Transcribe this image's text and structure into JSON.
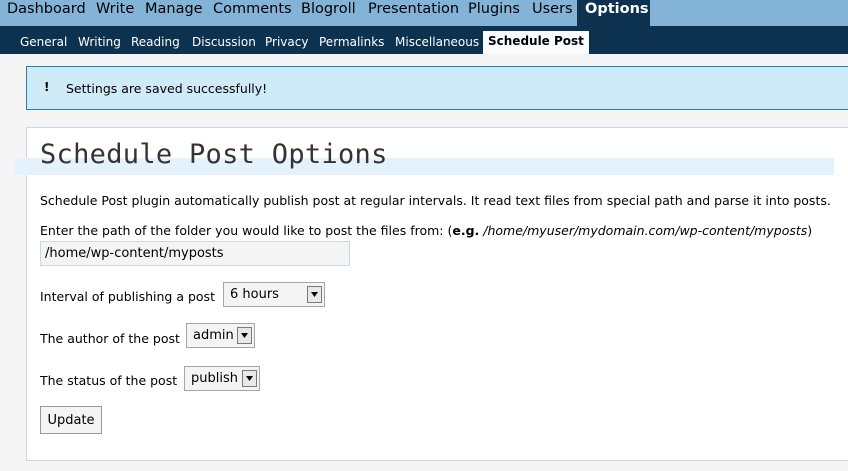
{
  "admin_menu": {
    "items": [
      {
        "label": "Dashboard"
      },
      {
        "label": "Write"
      },
      {
        "label": "Manage"
      },
      {
        "label": "Comments"
      },
      {
        "label": "Blogroll"
      },
      {
        "label": "Presentation"
      },
      {
        "label": "Plugins"
      },
      {
        "label": "Users"
      },
      {
        "label": "Options"
      }
    ],
    "active": "Options"
  },
  "sub_menu": {
    "items": [
      {
        "label": "General"
      },
      {
        "label": "Writing"
      },
      {
        "label": "Reading"
      },
      {
        "label": "Discussion"
      },
      {
        "label": "Privacy"
      },
      {
        "label": "Permalinks"
      },
      {
        "label": "Miscellaneous"
      },
      {
        "label": "Schedule Post"
      }
    ],
    "active": "Schedule Post"
  },
  "message": {
    "icon": "!",
    "text": "Settings are saved successfully!"
  },
  "page": {
    "title": "Schedule Post Options",
    "description": "Schedule Post plugin automatically publish post at regular intervals. It read text files from special path and parse it into posts.",
    "path_label_prefix": "Enter the path of the folder you would like to post the files from: (",
    "path_label_eg": "e.g.",
    "path_label_example": "/home/myuser/mydomain.com/wp-content/myposts",
    "path_label_suffix": ")",
    "path_value": "/home/wp-content/myposts",
    "interval_label": "Interval of publishing a post",
    "interval_value": "6 hours",
    "author_label": "The author of the post",
    "author_value": "admin",
    "status_label": "The status of the post",
    "status_value": "publish",
    "update_label": "Update"
  },
  "colors": {
    "menu_bg": "#83b4d8",
    "submenu_bg": "#0d324f",
    "message_bg": "#cfebf7",
    "message_border": "#2580b2",
    "title_highlight": "#e4f2fd"
  }
}
